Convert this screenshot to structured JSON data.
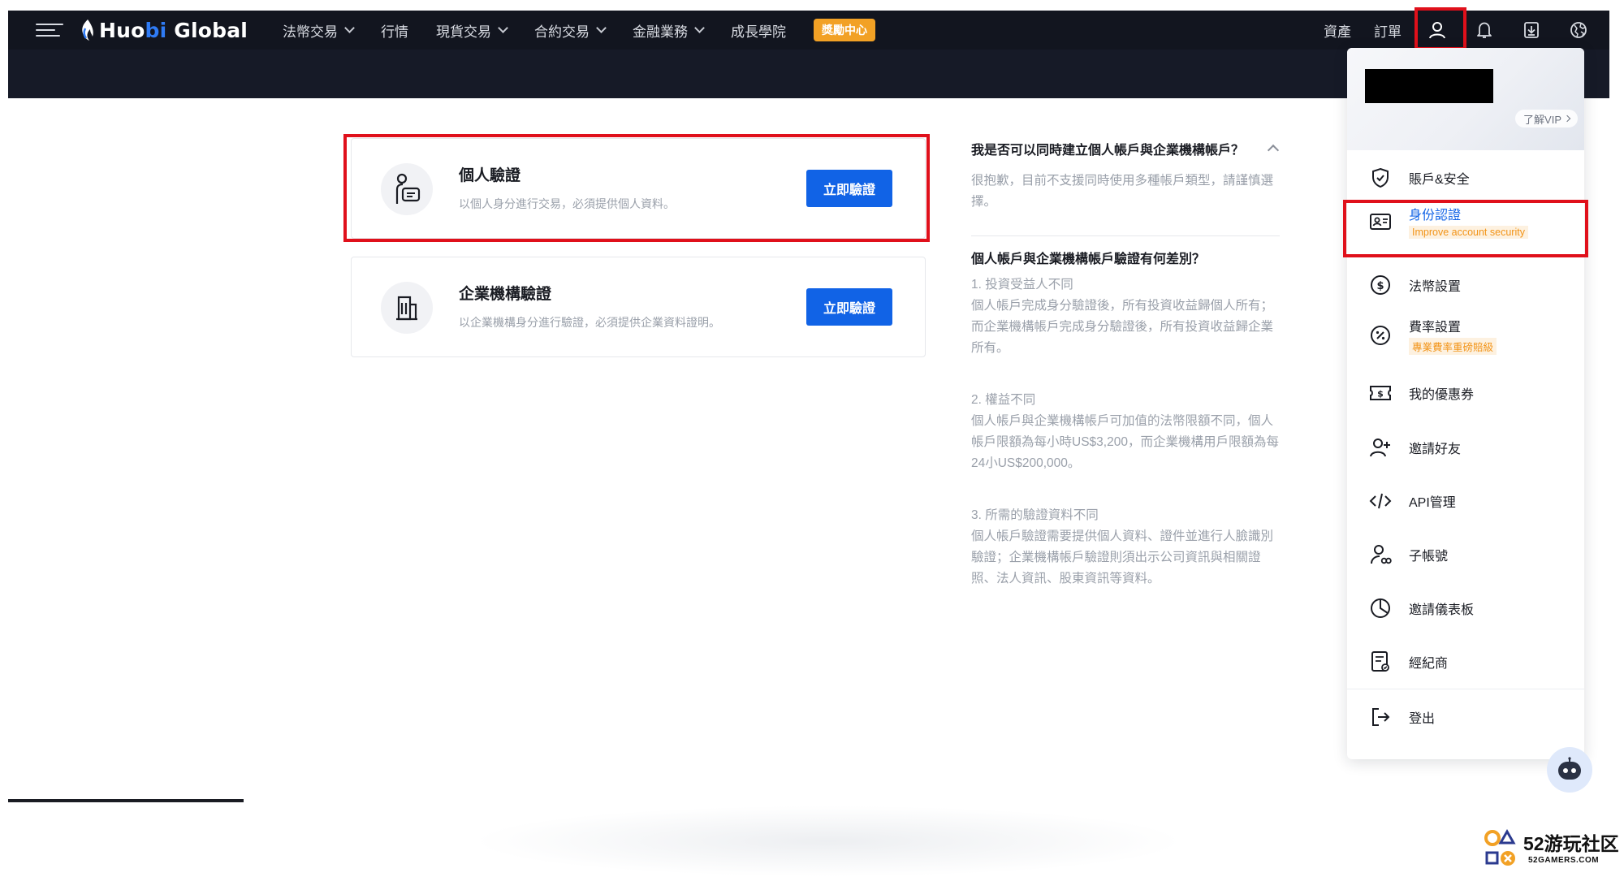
{
  "header": {
    "logo_prefix": "Huo",
    "logo_accent": "bi",
    "logo_suffix": " Global",
    "nav": [
      {
        "label": "法幣交易",
        "has_dropdown": true
      },
      {
        "label": "行情",
        "has_dropdown": false
      },
      {
        "label": "現貨交易",
        "has_dropdown": true
      },
      {
        "label": "合約交易",
        "has_dropdown": true
      },
      {
        "label": "金融業務",
        "has_dropdown": true
      },
      {
        "label": "成長學院",
        "has_dropdown": false
      }
    ],
    "promo_label": "獎勵中心",
    "assets_label": "資產",
    "orders_label": "訂單",
    "right_icons": [
      "user-icon",
      "bell-icon",
      "download-icon",
      "globe-icon"
    ]
  },
  "cards": [
    {
      "title": "個人驗證",
      "desc": "以個人身分進行交易，必須提供個人資料。",
      "button": "立即驗證",
      "icon": "personal-id-icon"
    },
    {
      "title": "企業機構驗證",
      "desc": "以企業機構身分進行驗證，必須提供企業資料證明。",
      "button": "立即驗證",
      "icon": "building-icon"
    }
  ],
  "faq": {
    "q1": "我是否可以同時建立個人帳戶與企業機構帳戶？",
    "a1": "很抱歉，目前不支援同時使用多種帳戶類型，請謹慎選擇。",
    "q2": "個人帳戶與企業機構帳戶驗證有何差別？",
    "points": [
      {
        "title": "1. 投資受益人不同",
        "body": "個人帳戶完成身分驗證後，所有投資收益歸個人所有；而企業機構帳戶完成身分驗證後，所有投資收益歸企業所有。"
      },
      {
        "title": "2. 權益不同",
        "body": "個人帳戶與企業機構帳戶可加值的法幣限額不同，個人帳戶限額為每小時US$3,200，而企業機構用戶限額為每24小US$200,000。"
      },
      {
        "title": "3. 所需的驗證資料不同",
        "body": "個人帳戶驗證需要提供個人資料、證件並進行人臉識別驗證；企業機構帳戶驗證則須出示公司資訊與相關證照、法人資訊、股東資訊等資料。"
      }
    ]
  },
  "dropdown": {
    "vip_link": "了解VIP",
    "items": [
      {
        "label": "賬戶&安全",
        "sub": "",
        "icon": "shield-check-icon",
        "active": false
      },
      {
        "label": "身份認證",
        "sub": "Improve account security",
        "icon": "id-card-icon",
        "active": true
      },
      {
        "label": "法幣設置",
        "sub": "",
        "icon": "dollar-circle-icon",
        "active": false
      },
      {
        "label": "費率設置",
        "sub": "專業費率重磅賠級",
        "icon": "percent-circle-icon",
        "active": false
      },
      {
        "label": "我的優惠券",
        "sub": "",
        "icon": "coupon-icon",
        "active": false
      },
      {
        "label": "邀請好友",
        "sub": "",
        "icon": "add-user-icon",
        "active": false
      },
      {
        "label": "API管理",
        "sub": "",
        "icon": "code-icon",
        "active": false
      },
      {
        "label": "子帳號",
        "sub": "",
        "icon": "sub-account-icon",
        "active": false
      },
      {
        "label": "邀請儀表板",
        "sub": "",
        "icon": "pie-chart-icon",
        "active": false
      },
      {
        "label": "經紀商",
        "sub": "",
        "icon": "broker-doc-icon",
        "active": false
      },
      {
        "label": "登出",
        "sub": "",
        "icon": "logout-icon",
        "active": false
      }
    ]
  },
  "watermark": {
    "big": "52游玩社区",
    "small": "52GAMERS.COM"
  },
  "colors": {
    "nav_bg": "#12151f",
    "primary": "#1163e6",
    "highlight": "#e0101b",
    "promo": "#f2a125",
    "active_text": "#1163e6"
  }
}
